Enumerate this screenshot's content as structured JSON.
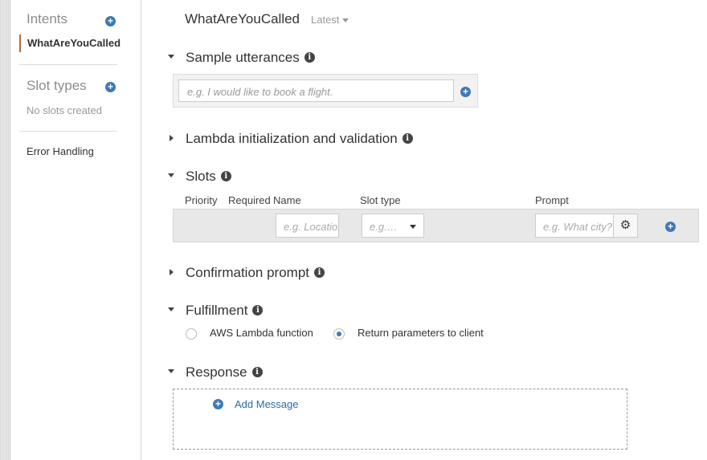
{
  "sidebar": {
    "intents_title": "Intents",
    "active_intent": "WhatAreYouCalled",
    "slot_types_title": "Slot types",
    "no_slots_text": "No slots created",
    "error_handling": "Error Handling"
  },
  "header": {
    "intent_name": "WhatAreYouCalled",
    "version": "Latest"
  },
  "sections": {
    "sample_utterances": "Sample utterances",
    "lambda_init": "Lambda initialization and validation",
    "slots": "Slots",
    "confirmation_prompt": "Confirmation prompt",
    "fulfillment": "Fulfillment",
    "response": "Response"
  },
  "utterance": {
    "placeholder": "e.g. I would like to book a flight."
  },
  "slots": {
    "columns": [
      "Priority",
      "Required",
      "Name",
      "Slot type",
      "Prompt"
    ],
    "name_placeholder": "e.g. Location",
    "type_placeholder": "e.g.…",
    "prompt_placeholder": "e.g. What city?"
  },
  "fulfillment": {
    "option_lambda": "AWS Lambda function",
    "option_return": "Return parameters to client",
    "selected": "return"
  },
  "response": {
    "add_message": "Add Message"
  },
  "colors": {
    "accent": "#3f79b3",
    "active_marker": "#b06c3a"
  }
}
